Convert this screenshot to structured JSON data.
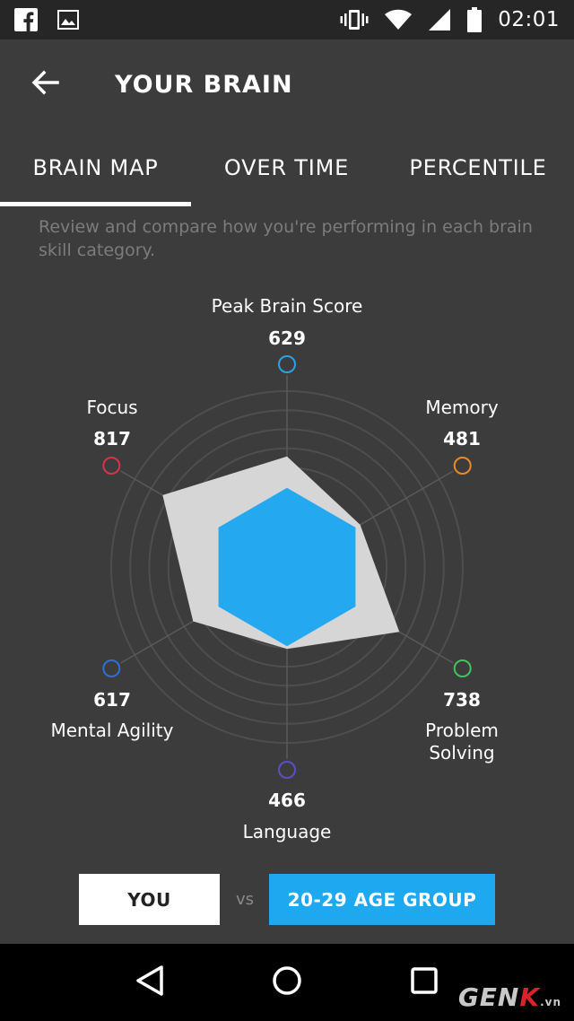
{
  "status_bar": {
    "time": "02:01",
    "left_icons": [
      "facebook-icon",
      "image-icon"
    ],
    "right_icons": [
      "vibrate-icon",
      "wifi-icon",
      "signal-icon",
      "battery-icon"
    ]
  },
  "app_bar": {
    "title": "YOUR BRAIN"
  },
  "tabs": [
    {
      "label": "BRAIN MAP",
      "active": true
    },
    {
      "label": "OVER TIME",
      "active": false
    },
    {
      "label": "PERCENTILE",
      "active": false
    }
  ],
  "description": "Review and compare how you're performing in each brain skill category.",
  "chart_data": {
    "type": "radar",
    "axes": [
      {
        "label": "Peak Brain Score",
        "value": 629,
        "color": "#2aa0e8"
      },
      {
        "label": "Memory",
        "value": 481,
        "color": "#e8892a"
      },
      {
        "label": "Problem Solving",
        "value": 738,
        "color": "#3fc45a"
      },
      {
        "label": "Language",
        "value": 466,
        "color": "#5a4fc8"
      },
      {
        "label": "Mental Agility",
        "value": 617,
        "color": "#2f6fd8"
      },
      {
        "label": "Focus",
        "value": 817,
        "color": "#d8334a"
      }
    ],
    "series": [
      {
        "name": "YOU",
        "values": [
          629,
          481,
          738,
          466,
          617,
          817
        ],
        "color": "#d6d6d6"
      },
      {
        "name": "20-29 AGE GROUP",
        "values": [
          450,
          450,
          450,
          450,
          450,
          450
        ],
        "color": "#24a9f0"
      }
    ],
    "ring_count": 6,
    "max": 1000
  },
  "compare": {
    "you_label": "YOU",
    "vs_label": "vs",
    "group_label": "20-29 AGE GROUP",
    "you_color": "#ffffff",
    "group_color": "#1ea8ef"
  },
  "watermark": {
    "main": "GEN",
    "accent": "K",
    "suffix": ".vn"
  }
}
